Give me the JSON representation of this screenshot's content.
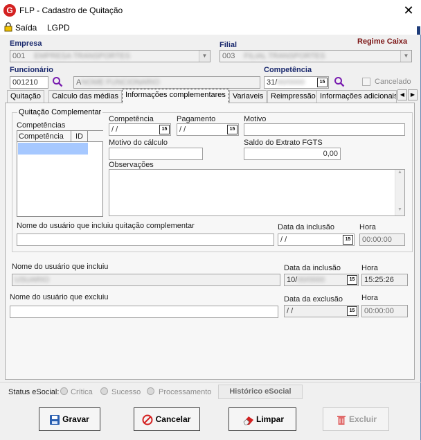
{
  "window": {
    "title": "FLP - Cadastro de Quitação",
    "logo_letter": "G"
  },
  "menu": {
    "exit_label": "Saída",
    "lgpd_label": "LGPD"
  },
  "header": {
    "empresa_label": "Empresa",
    "empresa_value": "001",
    "empresa_name": "EMPRESA TRANSPORTES",
    "filial_label": "Filial",
    "filial_value": "003",
    "filial_name": "FILIAL TRANSPORTES",
    "regime_label": "Regime Caixa",
    "funcionario_label": "Funcionário",
    "funcionario_code": "001210",
    "funcionario_name": "A",
    "funcionario_name_hidden": "NOME FUNCIONARIO",
    "competencia_label": "Competência",
    "competencia_value": "31/",
    "competencia_hidden": "00/0000",
    "cancelado_label": "Cancelado"
  },
  "tabs": [
    {
      "label": "Quitação"
    },
    {
      "label": "Calculo das médias"
    },
    {
      "label": "Informações complementares"
    },
    {
      "label": "Variaveis"
    },
    {
      "label": "Reimpressão"
    },
    {
      "label": "Informações adicionais"
    }
  ],
  "complement": {
    "group_label": "Quitação Complementar",
    "competencias_label": "Competências",
    "col_competencia": "Competência",
    "col_id": "ID",
    "competencia_label": "Competência",
    "competencia_value": " / /",
    "pagamento_label": "Pagamento",
    "pagamento_value": " / /",
    "motivo_label": "Motivo",
    "motivo_value": "",
    "motivo_calculo_label": "Motivo do cálculo",
    "saldo_label": "Saldo do Extrato FGTS",
    "saldo_value": "0,00",
    "observacoes_label": "Observações",
    "user_inc_label": "Nome do usuário que incluiu quitação complementar",
    "data_inc_label": "Data da inclusão",
    "data_inc_value": " / /",
    "hora_label": "Hora",
    "hora_value": "00:00:00"
  },
  "audit": {
    "user_inc_label": "Nome do usuário que incluiu",
    "user_inc_hidden": "USUARIO",
    "data_inc_label": "Data da inclusão",
    "data_inc_value": "10/",
    "data_inc_hidden": "00/0000",
    "hora_inc_label": "Hora",
    "hora_inc_value": "15:25:26",
    "user_exc_label": "Nome do usuário que excluiu",
    "data_exc_label": "Data da exclusão",
    "data_exc_value": " / /",
    "hora_exc_label": "Hora",
    "hora_exc_value": "00:00:00"
  },
  "status_bar": {
    "label": "Status eSocial:",
    "options": [
      "Crítica",
      "Sucesso",
      "Processamento"
    ],
    "history_button": "Histórico eSocial"
  },
  "buttons": {
    "save": "Gravar",
    "cancel": "Cancelar",
    "clear": "Limpar",
    "delete": "Excluir"
  },
  "calendar_icon_text": "15",
  "colors": {
    "label_blue": "#1b2a6e",
    "regime_red": "#7a1212",
    "accent_purple": "#7a1fb0",
    "selection_blue": "#a6c8ff"
  }
}
